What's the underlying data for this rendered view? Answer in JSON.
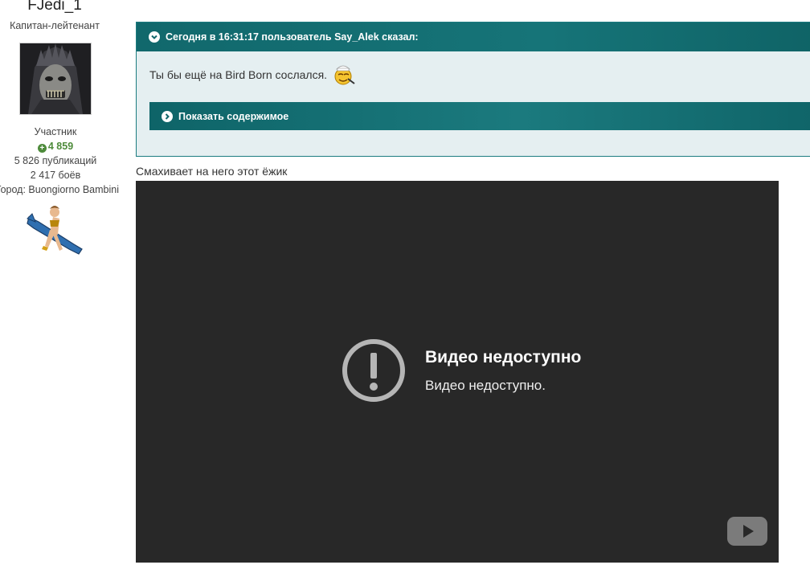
{
  "author": {
    "name": "FJedi_1",
    "rank": "Капитан-лейтенант",
    "group": "Участник",
    "reputation": "4 859",
    "posts": "5 826 публикаций",
    "battles": "2 417 боёв",
    "city": "Город: Buongiorno Bambini"
  },
  "quote": {
    "header": "Сегодня в 16:31:17 пользователь Say_Alek сказал:",
    "text": "Ты бы ещё на Bird Born сослался.",
    "spoiler_label": "Показать содержимое",
    "accent_color": "#11686c"
  },
  "post": {
    "text": "Смахивает на него этот ёжик"
  },
  "video": {
    "title": "Видео недоступно",
    "subtitle": "Видео недоступно.",
    "icons": [
      "warning-icon",
      "youtube-play-icon"
    ]
  }
}
